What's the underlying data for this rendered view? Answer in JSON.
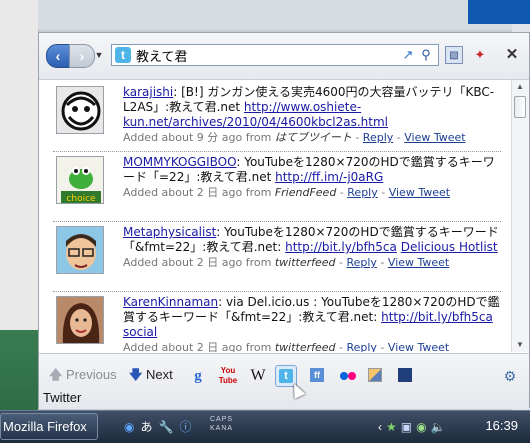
{
  "search": {
    "value": "教えて君"
  },
  "tweets": [
    {
      "user": "karajishi",
      "text": ": [B!] ガンガン使える実売4600円の大容量バッテリ「KBC-L2AS」:教えて君.net ",
      "links": [
        "http://www.oshiete-kun.net/archives/2010/04/4600kbcl2as.html"
      ],
      "meta_prefix": "Added about 9 分 ago from ",
      "via": "はてブツイート",
      "reply": "Reply",
      "view": "View Tweet"
    },
    {
      "user": "MOMMYKOGGIBOO",
      "text": ": YouTubeを1280×720のHDで鑑賞するキーワード「=22」:教えて君.net ",
      "links": [
        "http://ff.im/-j0aRG"
      ],
      "meta_prefix": "Added about 2 日 ago from ",
      "via": "FriendFeed",
      "reply": "Reply",
      "view": "View Tweet"
    },
    {
      "user": "Metaphysicalist",
      "text": ": YouTubeを1280×720のHDで鑑賞するキーワード「&fmt=22」:教えて君.net: ",
      "links": [
        "http://bit.ly/bfh5ca",
        "Delicious Hotlist"
      ],
      "meta_prefix": "Added about 2 日 ago from ",
      "via": "twitterfeed",
      "reply": "Reply",
      "view": "View Tweet"
    },
    {
      "user": "KarenKinnaman",
      "text": ": via Del.icio.us : YouTubeを1280×720のHDで鑑賞するキーワード「&fmt=22」:教えて君.net: ",
      "links": [
        "http://bit.ly/bfh5ca",
        "social"
      ],
      "meta_prefix": "Added about 2 日 ago from ",
      "via": "twitterfeed",
      "reply": "Reply",
      "view": "View Tweet"
    }
  ],
  "footer": {
    "previous": "Previous",
    "next": "Next",
    "label": "Twitter",
    "google": "g",
    "youtube_top": "You",
    "youtube_bottom": "Tube",
    "wiki": "W"
  },
  "taskbar": {
    "app": "Mozilla Firefox",
    "ime_mode": "あ",
    "caps": "CAPS",
    "kana": "KANA",
    "clock": "16:39"
  }
}
